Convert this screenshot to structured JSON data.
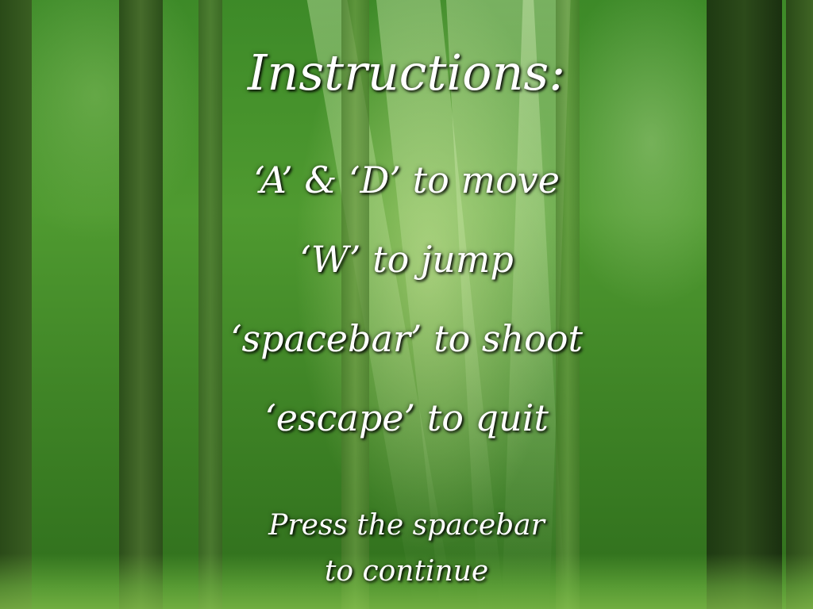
{
  "title": "Instructions:",
  "instructions": [
    "‘A’ & ‘D’ to move",
    "‘W’ to jump",
    "‘spacebar’ to shoot",
    "‘escape’ to quit"
  ],
  "prompt": {
    "line1": "Press the spacebar",
    "line2": "to continue"
  },
  "colors": {
    "text": "#ffffff",
    "forest_light": "#4f9a30",
    "forest_dark": "#2f6e1c",
    "trunk": "#1e3a12"
  }
}
